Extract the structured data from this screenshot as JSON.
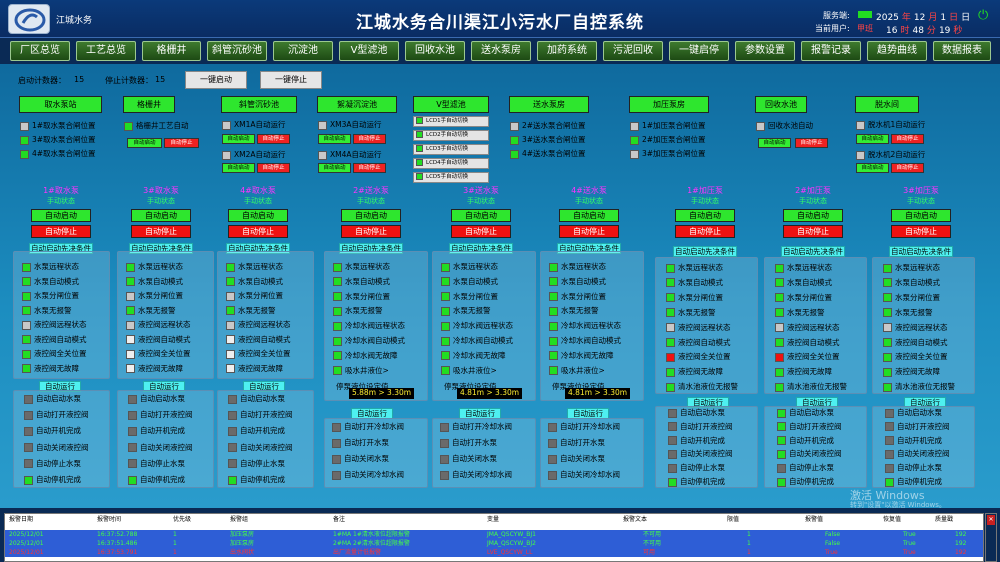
{
  "header": {
    "brand": "江城水务",
    "title": "江城水务合川渠江小污水厂自控系统",
    "service_label": "服务端:",
    "user_label": "当前用户:",
    "user": "甲班",
    "year": "2025",
    "month": "12",
    "day": "1",
    "weekday": "日",
    "hour": "16",
    "minute": "48",
    "second": "19",
    "y_unit": "年",
    "m_unit": "月",
    "d_unit": "日",
    "h_unit": "时",
    "min_unit": "分",
    "s_unit": "秒",
    "power_icon": "power-icon",
    "service_color": "#22dd22"
  },
  "nav": [
    "厂区总览",
    "工艺总览",
    "格栅井",
    "斜管沉砂池",
    "沉淀池",
    "V型滤池",
    "回收水池",
    "送水泵房",
    "加药系统",
    "污泥回收",
    "一键启停",
    "参数设置",
    "报警记录",
    "趋势曲线",
    "数据报表"
  ],
  "counters": {
    "start_label": "启动计数器：",
    "start_value": "15",
    "stop_label": "停止计数器：",
    "stop_value": "15",
    "start_btn": "一键启动",
    "stop_btn": "一键停止"
  },
  "groups": {
    "g1": {
      "title": "取水泵站",
      "items": [
        "1#取水泵合闸位置",
        "3#取水泵合闸位置",
        "4#取水泵合闸位置"
      ]
    },
    "g2": {
      "title": "格栅井",
      "item": "格栅井工艺自动",
      "auto": "自动启动",
      "stop": "自动停止"
    },
    "g3": {
      "title": "斜管沉砂池",
      "item1": "XM1A自动运行",
      "item2": "XM2A自动运行",
      "auto": "自动启动",
      "stop": "自动停止"
    },
    "g4": {
      "title": "絮凝沉淀池",
      "item1": "XM3A自动运行",
      "item2": "XM4A自动运行",
      "auto": "自动启动",
      "stop": "自动停止"
    },
    "g5": {
      "title": "V型滤池",
      "lcd": [
        "LCD1手自动切换",
        "LCD2手自动切换",
        "LCD3手自动切换",
        "LCD4手自动切换",
        "LCD5手自动切换"
      ]
    },
    "g6": {
      "title": "送水泵房",
      "items": [
        "2#送水泵合闸位置",
        "3#送水泵合闸位置",
        "4#送水泵合闸位置"
      ]
    },
    "g7": {
      "title": "加压泵房",
      "items": [
        "1#加压泵合闸位置",
        "2#加压泵合闸位置",
        "3#加压泵合闸位置"
      ]
    },
    "g8": {
      "title": "回收水池",
      "item": "回收水池自动",
      "auto": "自动启动",
      "stop": "自动停止"
    },
    "g9": {
      "title": "脱水间",
      "item1": "脱水机1自动运行",
      "item2": "脱水机2自动运行",
      "auto": "自动启动",
      "stop": "自动停止"
    }
  },
  "pump_common": {
    "state": "手动状态",
    "auto_start": "自动启动",
    "auto_stop": "自动停止",
    "precond": "自动启动先决条件",
    "auto_run": "自动运行"
  },
  "pumps": [
    "1#取水泵",
    "3#取水泵",
    "4#取水泵",
    "2#送水泵",
    "3#送水泵",
    "4#送水泵",
    "1#加压泵",
    "2#加压泵",
    "3#加压泵"
  ],
  "cond_intake": [
    "水泵远程状态",
    "水泵自动模式",
    "水泵分闸位置",
    "水泵无报警",
    "液控阀远程状态",
    "液控阀自动模式",
    "液控阀全关位置",
    "液控阀无故障"
  ],
  "cond_send": [
    "水泵远程状态",
    "水泵自动模式",
    "水泵分闸位置",
    "水泵无报警",
    "冷却水阀远程状态",
    "冷却水阀自动模式",
    "冷却水阀无故障",
    "吸水井液位>",
    "停泵液位设定值"
  ],
  "cond_press": [
    "水泵远程状态",
    "水泵自动模式",
    "水泵分闸位置",
    "水泵无报警",
    "液控阀远程状态",
    "液控阀自动模式",
    "液控阀全关位置",
    "液控阀无故障",
    "清水池液位无报警"
  ],
  "levels": [
    "5.88m > 3.30m",
    "4.81m > 3.30m",
    "4.81m > 3.30m"
  ],
  "run_intake": [
    "自动启动水泵",
    "自动打开液控阀",
    "自动开机完成",
    "自动关闭液控阀",
    "自动停止水泵",
    "自动停机完成"
  ],
  "run_send": [
    "自动打开冷却水阀",
    "自动打开水泵",
    "自动关闭水泵",
    "自动关闭冷却水阀"
  ],
  "alarm": {
    "headers": [
      "报警日期",
      "报警时间",
      "优先级",
      "报警组",
      "备注",
      "变量",
      "报警文本",
      "限值",
      "报警值",
      "恢复值",
      "质量戳"
    ],
    "rows": [
      [
        "2025/12/01",
        "16:37:52.788",
        "1",
        "加压泵房",
        "1#MA 1#清水液位超限报警",
        "JMA_QSCYW_BJ1",
        "不可用",
        "1",
        "False",
        "True",
        "192"
      ],
      [
        "2025/12/01",
        "16:37:51.486",
        "1",
        "加压泵房",
        "2#MA 2#清水液位超限报警",
        "JMA_QSCYW_BJ2",
        "不可用",
        "1",
        "False",
        "True",
        "192"
      ],
      [
        "2025/12/01",
        "16:37:53.791",
        "1",
        "出水阀状",
        "出厂流量计低报警",
        "LVE_QSCYW_LL",
        "可用",
        "1",
        "True",
        "True",
        "192"
      ]
    ]
  },
  "watermark": {
    "line1": "激活 Windows",
    "line2": "转到\"设置\"以激活 Windows。"
  },
  "scrollbar_label": "✕"
}
